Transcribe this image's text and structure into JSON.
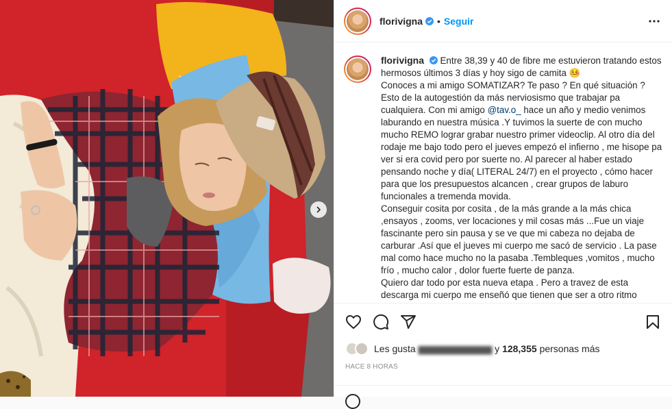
{
  "header": {
    "username": "florivigna",
    "separator": "•",
    "follow_label": "Seguir"
  },
  "caption": {
    "username": "florivigna",
    "text_intro": "Entre 38,39 y 40 de fibre me estuvieron tratando estos hermosos últimos 3 días y hoy sigo de camita",
    "emoji": "🤒",
    "p2": "Conoces a mi amigo SOMATIZAR? Te paso ? En qué situación ?",
    "p3a": "Esto de la autogestión da más nerviosismo que trabajar pa cualquiera. Con mi amigo ",
    "mention": "@tav.o_",
    "p3b": " hace un año y medio venimos laburando en nuestra música .Y tuvimos la suerte de con mucho mucho REMO lograr grabar nuestro primer videoclip. Al otro día del rodaje me bajo todo pero el jueves empezó el infierno , me hisope pa ver si era covid pero por suerte no. Al parecer al haber estado pensando noche y día( LITERAL 24/7) en el proyecto , cómo hacer para que los presupuestos alcancen , crear grupos de laburo funcionales a tremenda movida.",
    "p4": "Conseguir cosita por cosita , de la más grande a la más chica ,ensayos , zooms, ver locaciones y mil cosas más ...Fue un viaje fascinante pero sin pausa y se ve que mi cabeza no dejaba de carburar .Así que el jueves mi cuerpo me sacó de servicio . La pase mal como hace mucho no la pasaba .Tembleques ,vomitos , mucho frío , mucho calor , dolor fuerte fuerte de panza.",
    "p5": "Quiero dar todo por esta nueva etapa . Pero a travez de esta descarga mi cuerpo me enseñó que tienen que ser a otro ritmo"
  },
  "likes": {
    "prefix": "Les gusta",
    "hidden_name": "",
    "suffix_mid": "y",
    "count": "128,355",
    "suffix": "personas más"
  },
  "timestamp": "HACE 8 HORAS",
  "icons": {
    "verified": "verified-badge-icon",
    "more": "more-options-icon",
    "like": "heart-icon",
    "comment": "comment-icon",
    "share": "paper-plane-icon",
    "save": "bookmark-icon",
    "next": "chevron-right-icon"
  },
  "colors": {
    "follow": "#0095f6",
    "verified": "#3897f0",
    "couch_red": "#d0232a",
    "pillow_yellow": "#f3b31b",
    "pillow_blue": "#77b8e4"
  }
}
